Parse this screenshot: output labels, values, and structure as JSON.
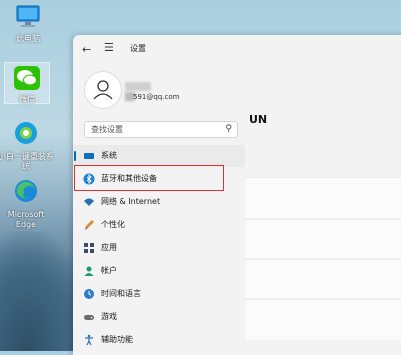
{
  "desktop": {
    "icons": [
      {
        "label": "此电脑",
        "icon": "computer-icon"
      },
      {
        "label": "微信",
        "icon": "wechat-icon"
      },
      {
        "label": "小白一键重装系统",
        "icon": "app-icon"
      },
      {
        "label": "Microsoft Edge",
        "icon": "edge-icon"
      }
    ]
  },
  "window": {
    "title": "设置",
    "account": {
      "email": "591@qq.com"
    },
    "search_placeholder": "查找设置",
    "header_partial": "UN",
    "nav": [
      {
        "label": "系统",
        "icon": "display-icon"
      },
      {
        "label": "蓝牙和其他设备",
        "icon": "bluetooth-icon"
      },
      {
        "label": "网络 & Internet",
        "icon": "wifi-icon"
      },
      {
        "label": "个性化",
        "icon": "brush-icon"
      },
      {
        "label": "应用",
        "icon": "apps-icon"
      },
      {
        "label": "帐户",
        "icon": "person-icon"
      },
      {
        "label": "时间和语言",
        "icon": "globe-clock-icon"
      },
      {
        "label": "游戏",
        "icon": "gamepad-icon"
      },
      {
        "label": "辅助功能",
        "icon": "accessibility-icon"
      }
    ]
  },
  "colors": {
    "accent": "#0067c0",
    "highlight": "#dd3333"
  }
}
